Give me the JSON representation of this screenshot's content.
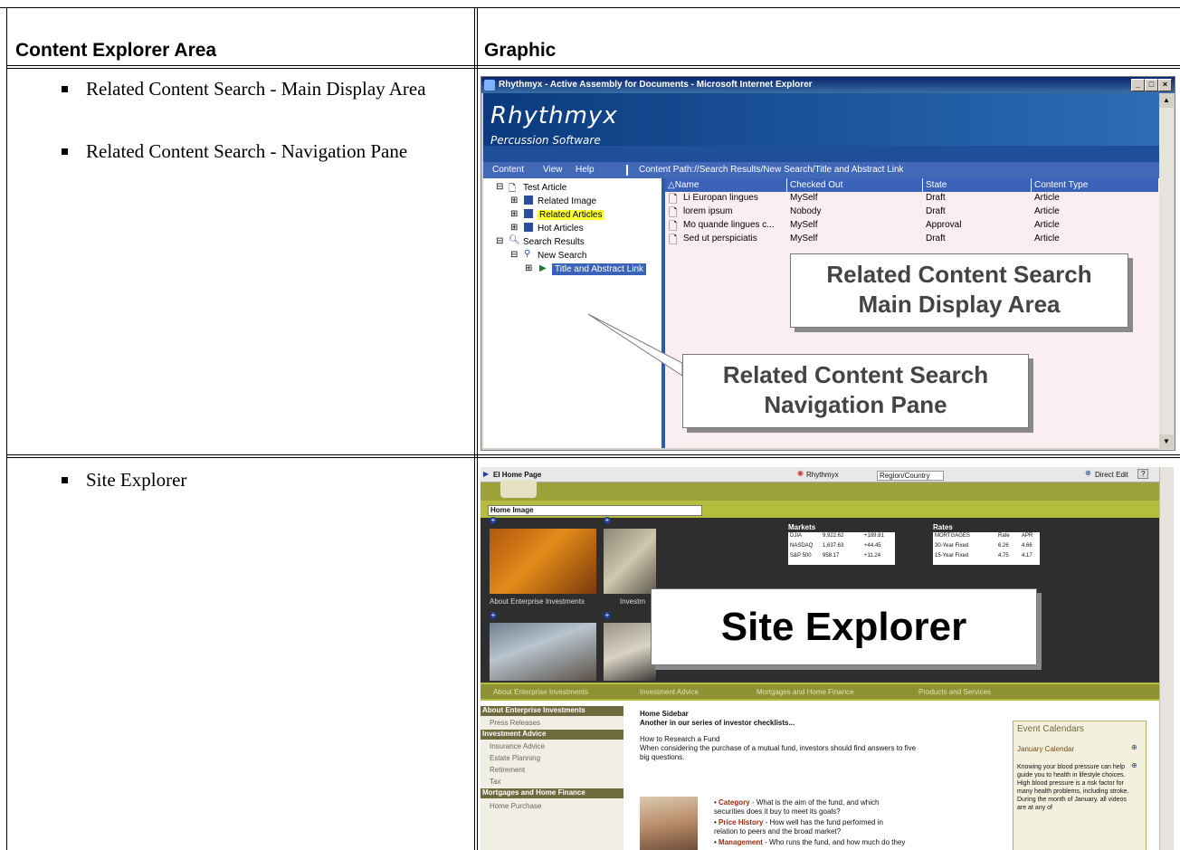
{
  "table": {
    "col1_header": "Content Explorer Area",
    "col2_header": "Graphic",
    "row1_items": [
      "Related Content Search - Main Display Area",
      "Related Content Search - Navigation Pane"
    ],
    "row2_items": [
      "Site Explorer"
    ]
  },
  "shot1": {
    "window_title": "Rhythmyx - Active Assembly for Documents - Microsoft Internet Explorer",
    "brand": "Rhythmyx",
    "tagline": "Percussion Software",
    "menu": [
      "Content",
      "View",
      "Help"
    ],
    "content_path": "Content Path://Search Results/New Search/Title and Abstract Link",
    "tree": {
      "root": "Test Article",
      "n1": "Related Image",
      "n2": "Related Articles",
      "n3": "Hot Articles",
      "n4": "Search Results",
      "n5": "New Search",
      "n6": "Title and Abstract Link"
    },
    "columns": [
      "Name",
      "Checked Out",
      "State",
      "Content Type"
    ],
    "rows": [
      [
        "Li Europan lingues",
        "MySelf",
        "Draft",
        "Article"
      ],
      [
        "lorem ipsum",
        "Nobody",
        "Draft",
        "Article"
      ],
      [
        "Mo quande lingues c...",
        "MySelf",
        "Approval",
        "Article"
      ],
      [
        "Sed ut perspiciatis",
        "MySelf",
        "Draft",
        "Article"
      ]
    ],
    "callout_main_1": "Related Content Search",
    "callout_main_2": "Main Display Area",
    "callout_nav_1": "Related Content Search",
    "callout_nav_2": "Navigation Pane"
  },
  "shot2": {
    "tab_label": "EI Home Page",
    "rhythmyx_link": "Rhythmyx",
    "region_select": "Region/Country",
    "direct_edit": "Direct Edit",
    "help": "?",
    "home_image_label": "Home Image",
    "markets_title": "Markets",
    "markets": [
      [
        "DJIA",
        "9,922.62",
        "+189.81"
      ],
      [
        "NASDAQ",
        "1,637.63",
        "+44.45"
      ],
      [
        "S&P 500",
        "958.17",
        "+11.24"
      ]
    ],
    "rates_title": "Rates",
    "rates": [
      [
        "MORTGAGES",
        "Rate",
        "APR"
      ],
      [
        "30-Year Fixed",
        "6.26",
        "4.66"
      ],
      [
        "15-Year Fixed",
        "4.75",
        "4.17"
      ]
    ],
    "caption_left": "About Enterprise Investments",
    "caption_right": "Investm",
    "callout": "Site Explorer",
    "nav_links": [
      "About Enterprise Investments",
      "Investment Advice",
      "Mortgages and Home Finance",
      "Products and Services"
    ],
    "sidebar": [
      {
        "text": "About Enterprise Investments",
        "head": true
      },
      {
        "text": "Press Releases",
        "head": false
      },
      {
        "text": "Investment Advice",
        "head": true
      },
      {
        "text": "Insurance Advice",
        "head": false
      },
      {
        "text": "Estate Planning",
        "head": false
      },
      {
        "text": "Retirement",
        "head": false
      },
      {
        "text": "Tax",
        "head": false
      },
      {
        "text": "Mortgages and Home Finance",
        "head": true
      },
      {
        "text": "Home Purchase",
        "head": false
      }
    ],
    "sidebar_title": "Home Sidebar",
    "sidebar_sub": "Another in our series of investor checklists...",
    "body_title": "How to Research a Fund",
    "body_text": "When considering the purchase of a mutual fund, investors should find answers to five big questions.",
    "bullets": [
      [
        "Category",
        " - What is the aim of the fund, and which securities does it buy to meet its goals?"
      ],
      [
        "Price History",
        " - How well has the fund performed in relation to peers and the broad market?"
      ],
      [
        "Management",
        " - Who runs the fund, and how much do they"
      ]
    ],
    "event_title": "Event Calendars",
    "event_link": "January Calendar",
    "event_text": "Knowing your blood pressure can help guide you to health in lifestyle choices. High blood pressure is a risk factor for many health problems, including stroke. During the month of January, all videos are at any of"
  }
}
